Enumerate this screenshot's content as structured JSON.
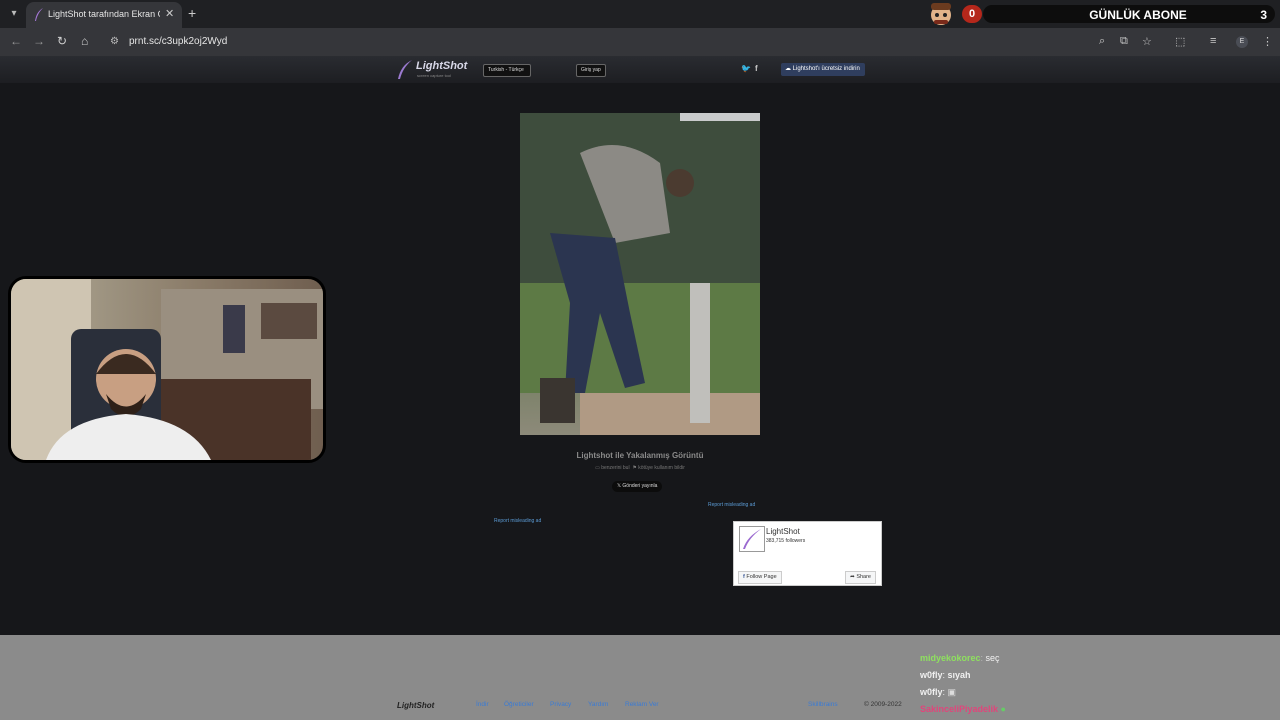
{
  "browser": {
    "tab_title": "LightShot tarafından Ekran Görüntüsü",
    "url": "prnt.sc/c3upk2oj2Wyd",
    "profile_initial": "E"
  },
  "stream_overlay": {
    "daily_subs_label": "GÜNLÜK ABONE",
    "left_count": "0",
    "right_count": "3"
  },
  "lightshot": {
    "logo_text": "LightShot",
    "tagline": "screen capture tool",
    "language": "Turkish - Türkçe",
    "login_label": "Giriş yap",
    "download_label": "Lightshot'ı ücretsiz indirin",
    "caption_title": "Lightshot ile Yakalanmış Görüntü",
    "find_similar": "benzerini bul",
    "report_abuse": "kötüye kullanım bildir",
    "tweet_label": "Gönderi yayınla",
    "report_ad": "Report misleading ad"
  },
  "facebook_box": {
    "name": "LightShot",
    "followers": "383,715 followers",
    "follow_label": "Follow Page",
    "share_label": "Share"
  },
  "footer": {
    "logo": "LightShot",
    "links": [
      "İndir",
      "Öğreticiler",
      "Privacy",
      "Yardım",
      "Reklam Ver"
    ],
    "brand": "Skillbrains",
    "copyright": "© 2009-2022"
  },
  "chat": [
    {
      "user": "midyekokorec",
      "text": "seç",
      "color": "#8ee05f"
    },
    {
      "user": "w0fly",
      "text": "sıyah",
      "color": "#f1f1f1"
    },
    {
      "user": "w0fly",
      "text": "",
      "color": "#f1f1f1"
    },
    {
      "user": "SakinceliPiyadelik",
      "text": "",
      "color": "#e0457b"
    }
  ],
  "colors": {
    "page_bg": "#16171a",
    "header_bg": "#2a2c31",
    "link": "#5b9bd5",
    "footer_bg": "#8b8b8b"
  }
}
